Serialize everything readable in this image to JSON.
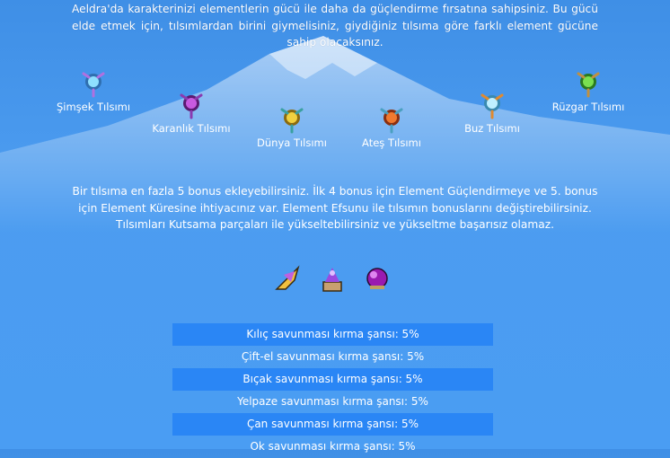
{
  "intro_text": "Aeldra'da karakterinizi elementlerin gücü ile daha da güçlendirme fırsatına sahipsiniz. Bu gücü elde etmek için, tılsımlardan birini giymelisiniz, giydiğiniz tılsıma göre farklı element gücüne sahip olacaksınız.",
  "talismans": [
    {
      "label": "Şimşek Tılsımı",
      "icon": "lightning-talisman-icon",
      "color": "#7fd4ff"
    },
    {
      "label": "Karanlık Tılsımı",
      "icon": "darkness-talisman-icon",
      "color": "#b04ad0"
    },
    {
      "label": "Dünya Tılsımı",
      "icon": "earth-talisman-icon",
      "color": "#e2c33a"
    },
    {
      "label": "Ateş Tılsımı",
      "icon": "fire-talisman-icon",
      "color": "#e2642a"
    },
    {
      "label": "Buz Tılsımı",
      "icon": "ice-talisman-icon",
      "color": "#9fe0f0"
    },
    {
      "label": "Rüzgar Tılsımı",
      "icon": "wind-talisman-icon",
      "color": "#6fcf4a"
    }
  ],
  "bonus_text": "Bir tılsıma en fazla 5 bonus ekleyebilirsiniz. İlk 4 bonus için Element Güçlendirmeye ve 5. bonus için Element Küresine ihtiyacınız var. Element Efsunu ile tılsımın bonuslarını değiştirebilirsiniz. Tılsımları Kutsama parçaları ile yükseltebilirsiniz ve yükseltme başarısız olamaz.",
  "items": [
    {
      "icon": "element-enhancer-icon"
    },
    {
      "icon": "element-enchant-icon"
    },
    {
      "icon": "element-orb-icon"
    }
  ],
  "stats": [
    "Kılıç savunması kırma şansı: 5%",
    "Çift-el savunması kırma şansı: 5%",
    "Bıçak savunması kırma şansı: 5%",
    "Yelpaze savunması kırma şansı: 5%",
    "Çan savunması kırma şansı: 5%",
    "Ok savunması kırma şansı: 5%"
  ],
  "colors": {
    "background": "#4a9df3",
    "row_highlight": "#2a86f5",
    "text": "#ffffff"
  }
}
